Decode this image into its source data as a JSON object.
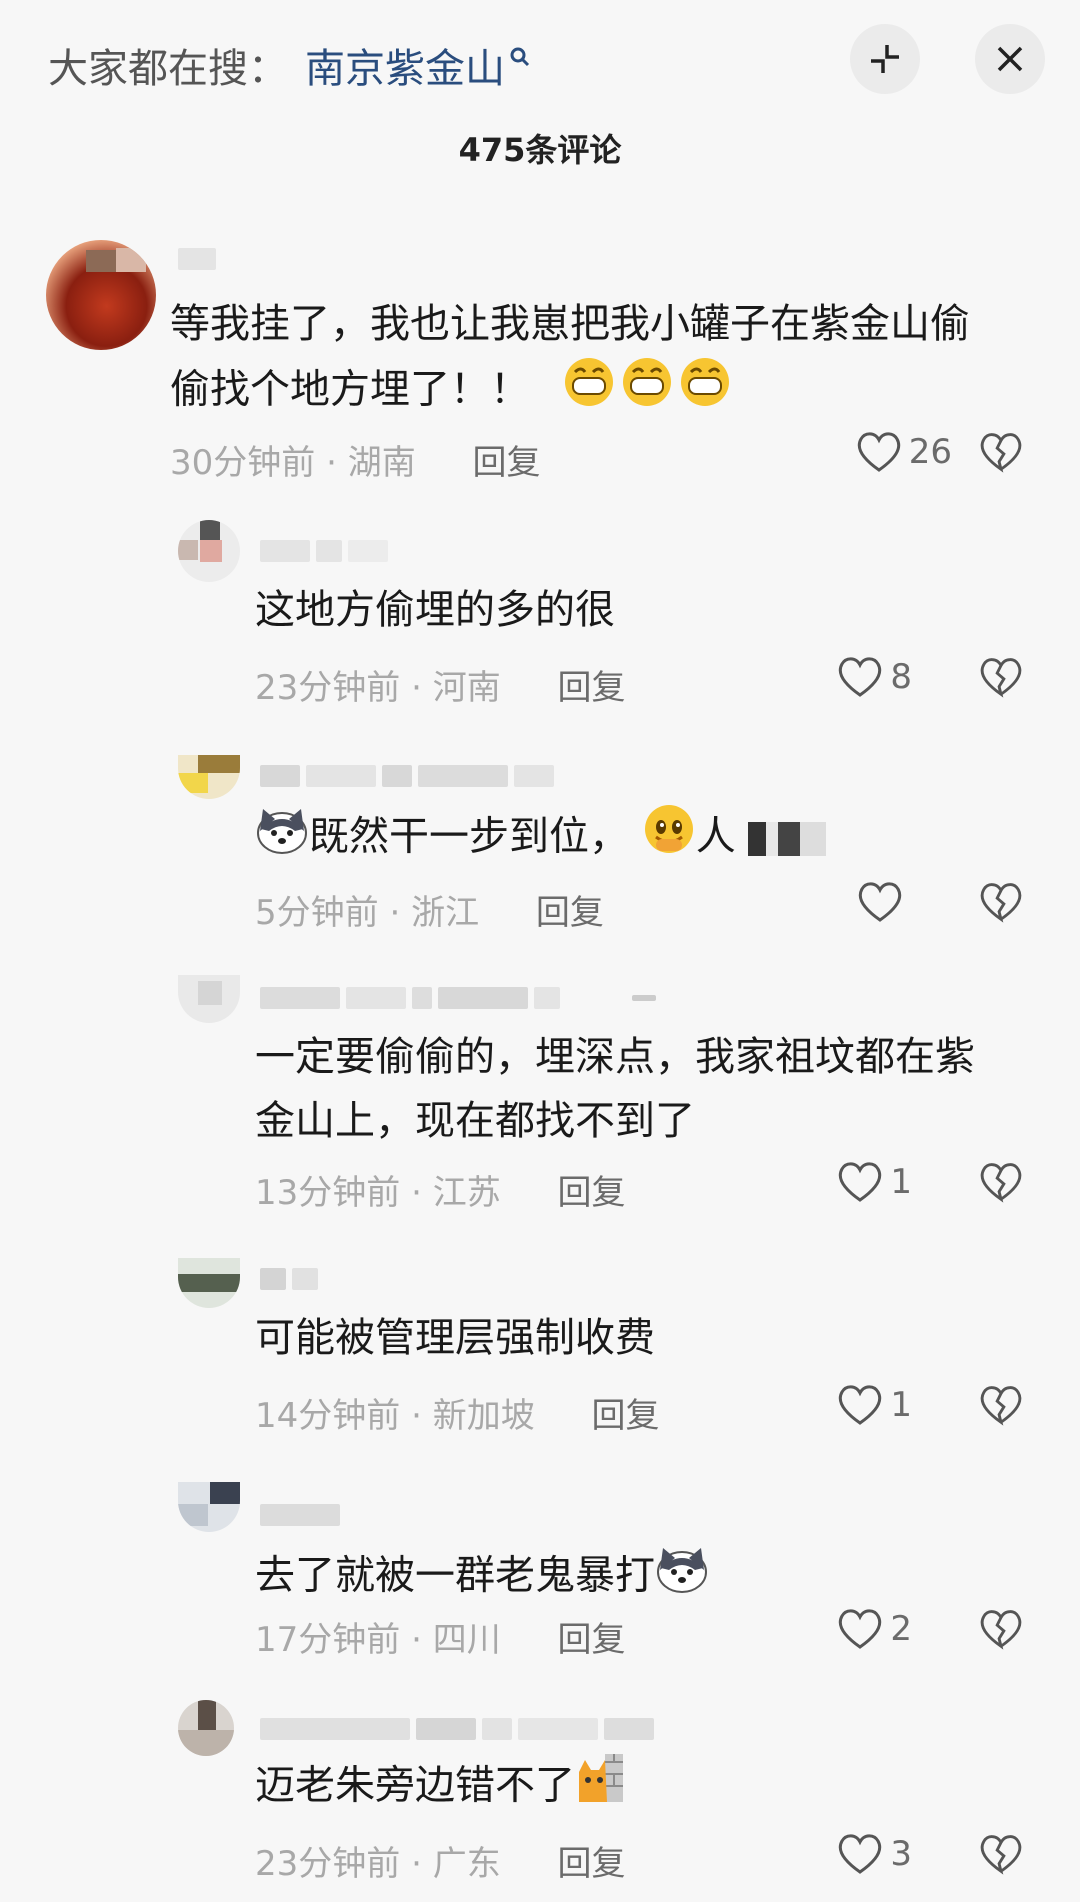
{
  "header": {
    "search_prefix": "大家都在搜：",
    "search_term": "南京紫金山",
    "comment_count": "475条评论"
  },
  "comments": [
    {
      "text_line1": "等我挂了，我也让我崽把我小罐子在紫金山偷",
      "text_line2": "偷找个地方埋了！！",
      "time": "30分钟前",
      "region": "湖南",
      "reply": "回复",
      "likes": "26"
    },
    {
      "text_line1": "这地方偷埋的多的很",
      "time": "23分钟前",
      "region": "河南",
      "reply": "回复",
      "likes": "8"
    },
    {
      "text_line1": "既然干一步到位，",
      "text_tail": "人",
      "time": "5分钟前",
      "region": "浙江",
      "reply": "回复",
      "likes": ""
    },
    {
      "text_line1": "一定要偷偷的，埋深点，我家祖坟都在紫",
      "text_line2": "金山上，现在都找不到了",
      "time": "13分钟前",
      "region": "江苏",
      "reply": "回复",
      "likes": "1"
    },
    {
      "text_line1": "可能被管理层强制收费",
      "time": "14分钟前",
      "region": "新加坡",
      "reply": "回复",
      "likes": "1"
    },
    {
      "text_line1": "去了就被一群老鬼暴打",
      "time": "17分钟前",
      "region": "四川",
      "reply": "回复",
      "likes": "2"
    },
    {
      "text_line1": "迈老朱旁边错不了",
      "time": "23分钟前",
      "region": "广东",
      "reply": "回复",
      "likes": "3"
    }
  ],
  "icons": {
    "search": "search-icon",
    "collapse": "collapse-icon",
    "close": "close-icon",
    "like": "heart-icon",
    "dislike": "broken-heart-icon"
  },
  "colors": {
    "background": "#f7f7f7",
    "search_term": "#2a4d7e",
    "meta": "#a8a8a8"
  }
}
